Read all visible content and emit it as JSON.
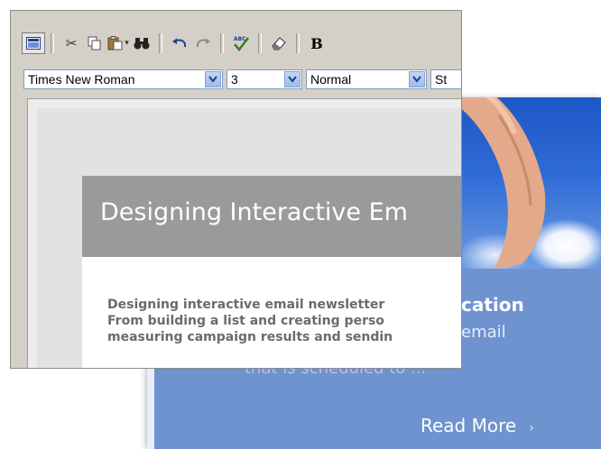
{
  "background_card": {
    "heading_fragment": "cation",
    "sub_fragment": "email",
    "faded_text": "that is scheduled to ...",
    "read_more": "Read More",
    "read_more_arrow": "›"
  },
  "editor": {
    "toolbar": {
      "buttons": [
        {
          "name": "design-view-icon",
          "glyph": "▣",
          "active": true
        },
        {
          "name": "cut-icon",
          "glyph": "✂"
        },
        {
          "name": "copy-icon",
          "glyph": "⎘"
        },
        {
          "name": "paste-icon",
          "glyph": "📋"
        },
        {
          "name": "find-icon",
          "glyph": "⌕"
        },
        {
          "name": "undo-icon",
          "glyph": "↶"
        },
        {
          "name": "redo-icon",
          "glyph": "↷"
        },
        {
          "name": "spellcheck-icon",
          "glyph": "✓"
        },
        {
          "name": "eraser-icon",
          "glyph": "⌫"
        },
        {
          "name": "bold-icon",
          "glyph": "B"
        }
      ],
      "paste_dropdown": "▾",
      "spellcheck_label": "ABC",
      "bold_label": "B"
    },
    "format_bar": {
      "font": "Times New Roman",
      "size": "3",
      "style": "Normal",
      "next": "St"
    },
    "document": {
      "title": "Designing Interactive Em",
      "body_lines": [
        "Designing interactive email newsletter",
        "From building a list and creating perso",
        "measuring campaign results and sendin"
      ]
    }
  },
  "colors": {
    "card_blue": "#6f93cf",
    "header_gray": "#9a9a9a",
    "body_text": "#6b6b6b",
    "window_chrome": "#d4d0c8"
  }
}
